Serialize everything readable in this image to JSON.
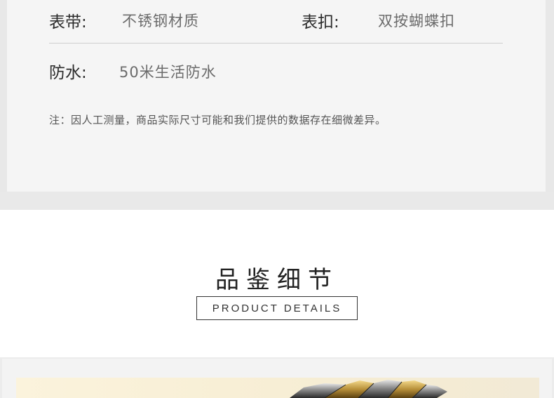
{
  "specs": {
    "strap_label": "表带:",
    "strap_value": "不锈钢材质",
    "clasp_label": "表扣:",
    "clasp_value": "双按蝴蝶扣",
    "water_label": "防水:",
    "water_value": "50米生活防水",
    "note": "注：因人工测量，商品实际尺寸可能和我们提供的数据存在细微差异。"
  },
  "details": {
    "title": "品鉴细节",
    "subtitle": "PRODUCT DETAILS"
  }
}
